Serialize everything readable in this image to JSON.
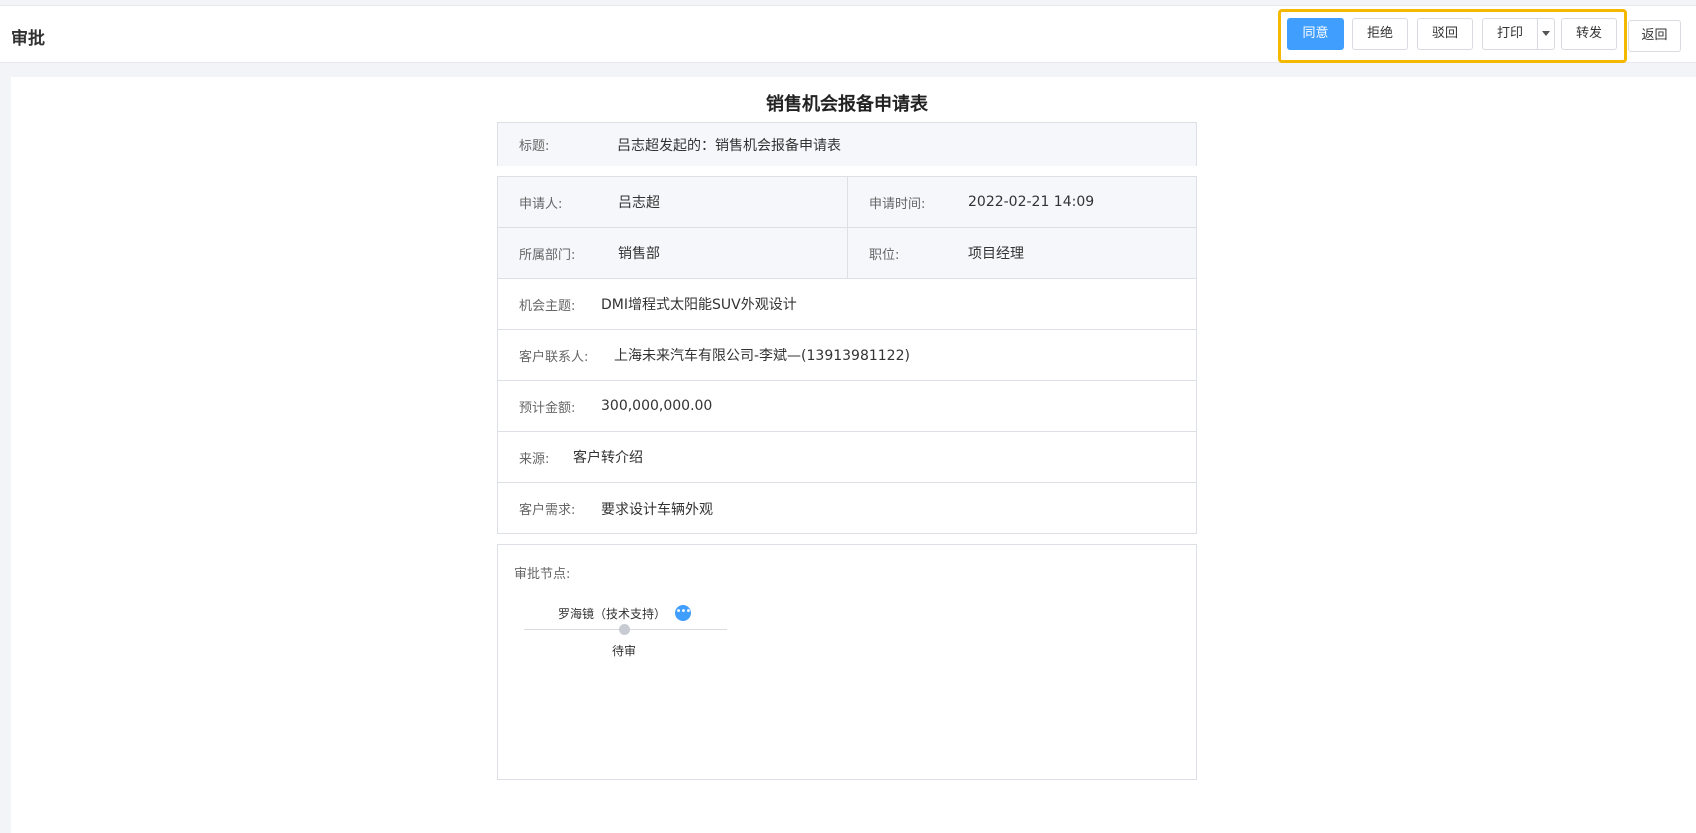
{
  "header": {
    "title": "审批",
    "actions": {
      "approve": "同意",
      "reject": "拒绝",
      "return": "驳回",
      "print": "打印",
      "forward": "转发"
    },
    "back": "返回"
  },
  "form": {
    "title": "销售机会报备申请表",
    "subject_label": "标题:",
    "subject_value": "吕志超发起的：销售机会报备申请表",
    "applicant_label": "申请人:",
    "applicant_value": "吕志超",
    "apply_time_label": "申请时间:",
    "apply_time_value": "2022-02-21 14:09",
    "dept_label": "所属部门:",
    "dept_value": "销售部",
    "position_label": "职位:",
    "position_value": "项目经理",
    "topic_label": "机会主题:",
    "topic_value": "DMI增程式太阳能SUV外观设计",
    "contact_label": "客户联系人:",
    "contact_value": "上海未来汽车有限公司-李斌—(13913981122)",
    "amount_label": "预计金额:",
    "amount_value": "300,000,000.00",
    "source_label": "来源:",
    "source_value": "客户转介绍",
    "demand_label": "客户需求:",
    "demand_value": "要求设计车辆外观"
  },
  "approval": {
    "label": "审批节点:",
    "node_name": "罗海镜（技术支持）",
    "node_more": "•••",
    "node_status": "待审"
  }
}
